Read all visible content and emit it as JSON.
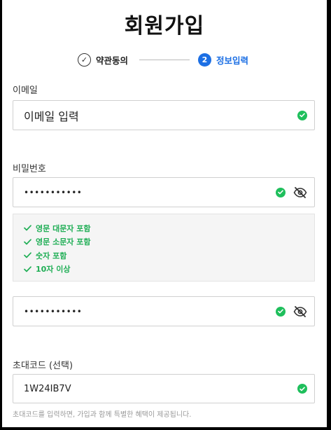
{
  "page": {
    "title": "회원가입"
  },
  "stepper": {
    "steps": [
      {
        "label": "약관동의",
        "state": "done",
        "icon": "check-circle-icon"
      },
      {
        "number": "2",
        "label": "정보입력",
        "state": "active"
      }
    ],
    "active_color": "#1c6fe4"
  },
  "email": {
    "label": "이메일",
    "value": "이메일 입력",
    "valid_icon": "check-circle-icon"
  },
  "password": {
    "label": "비밀번호",
    "value": "•••••••••••",
    "valid_icon": "check-circle-icon",
    "visibility_icon": "eye-off-icon"
  },
  "password_rules": {
    "color": "#1fae55",
    "items": [
      "영문 대문자 포함",
      "영문 소문자 포함",
      "숫자 포함",
      "10자 이상"
    ]
  },
  "password_confirm": {
    "value": "•••••••••••",
    "valid_icon": "check-circle-icon",
    "visibility_icon": "eye-off-icon"
  },
  "invite": {
    "label": "초대코드 (선택)",
    "value": "1W24IB7V",
    "valid_icon": "check-circle-icon",
    "helper": "초대코드를 입력하면, 가입과 함께 특별한 혜택이 제공됩니다."
  },
  "colors": {
    "success": "#1fbf5c",
    "accent": "#1c6fe4"
  }
}
